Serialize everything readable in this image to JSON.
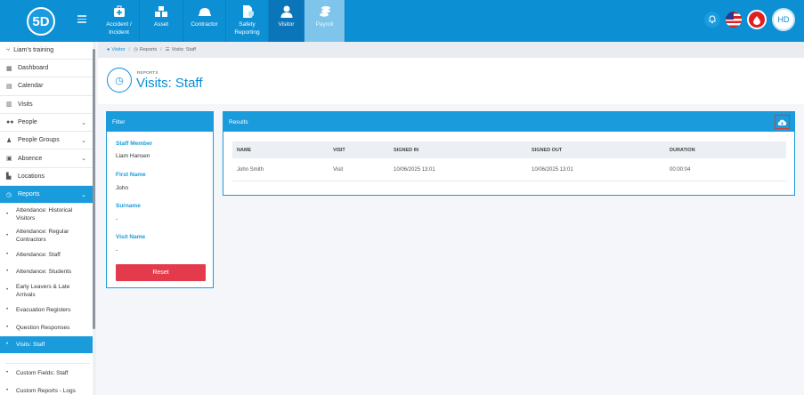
{
  "app": {
    "logo_text": "5D"
  },
  "nav": {
    "items": [
      {
        "label": "Accident / Incident",
        "icon": "first-aid-kit-icon"
      },
      {
        "label": "Asset",
        "icon": "boxes-icon"
      },
      {
        "label": "Contractor",
        "icon": "hard-hat-icon"
      },
      {
        "label": "Safety Reporting",
        "icon": "shield-report-icon"
      },
      {
        "label": "Visitor",
        "icon": "person-icon"
      },
      {
        "label": "Payroll",
        "icon": "coins-icon"
      }
    ],
    "active": "Visitor"
  },
  "topright": {
    "avatar_initials": "HD"
  },
  "sidebar": {
    "header": "Liam's training",
    "items": [
      {
        "label": "Dashboard",
        "icon": "dashboard-icon",
        "chevron": false
      },
      {
        "label": "Calendar",
        "icon": "calendar-icon",
        "chevron": false
      },
      {
        "label": "Visits",
        "icon": "calendar-check-icon",
        "chevron": false
      },
      {
        "label": "People",
        "icon": "people-icon",
        "chevron": true
      },
      {
        "label": "People Groups",
        "icon": "group-icon",
        "chevron": true
      },
      {
        "label": "Absence",
        "icon": "absence-icon",
        "chevron": true
      },
      {
        "label": "Locations",
        "icon": "building-icon",
        "chevron": false
      },
      {
        "label": "Reports",
        "icon": "clock-icon",
        "chevron": true
      }
    ],
    "subitems": [
      {
        "label": "Attendance: Historical Visitors"
      },
      {
        "label": "Attendance: Regular Contractors"
      },
      {
        "label": "Attendance: Staff"
      },
      {
        "label": "Attendance: Students"
      },
      {
        "label": "Early Leavers & Late Arrivals"
      },
      {
        "label": "Evacuation Registers"
      },
      {
        "label": "Question Responses"
      },
      {
        "label": "Visits: Staff"
      },
      {
        "label": "Custom Fields: Staff"
      },
      {
        "label": "Custom Reports - Logs"
      }
    ]
  },
  "breadcrumb": {
    "items": [
      "Visitor",
      "Reports",
      "Visits: Staff"
    ]
  },
  "page": {
    "supertitle": "REPORTS",
    "title": "Visits: Staff"
  },
  "filter": {
    "title": "Filter",
    "fields": [
      {
        "label": "Staff Member",
        "value": "Liam Hansen"
      },
      {
        "label": "First Name",
        "value": "John"
      },
      {
        "label": "Surname",
        "value": "-"
      },
      {
        "label": "Visit Name",
        "value": "-"
      }
    ],
    "reset_label": "Reset"
  },
  "results": {
    "title": "Results",
    "columns": [
      "NAME",
      "VISIT",
      "SIGNED IN",
      "SIGNED OUT",
      "DURATION"
    ],
    "rows": [
      [
        "John Smith",
        "Visit",
        "10/06/2025 13:01",
        "10/06/2025 13:01",
        "00:00:04"
      ]
    ]
  },
  "colors": {
    "brand": "#0d8fd4",
    "panel_accent": "#1a9bdc",
    "reset": "#e33b4b"
  }
}
